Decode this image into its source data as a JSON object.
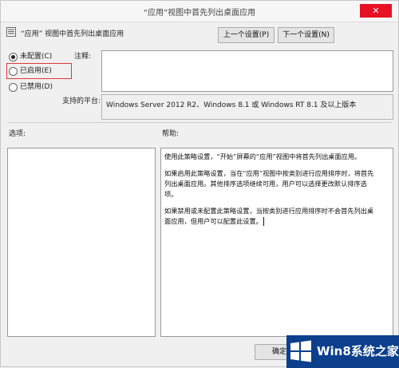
{
  "window": {
    "title": "“应用”视图中首先列出桌面应用",
    "close_glyph": "✕"
  },
  "header": {
    "policy_name": "“应用” 视图中首先列出桌面应用",
    "prev_label": "上一个设置(P)",
    "next_label": "下一个设置(N)"
  },
  "state": {
    "options": [
      {
        "label": "未配置(C)",
        "selected": true
      },
      {
        "label": "已启用(E)",
        "selected": false
      },
      {
        "label": "已禁用(D)",
        "selected": false
      }
    ]
  },
  "comment": {
    "label": "注释:",
    "value": ""
  },
  "platform": {
    "label": "支持的平台:",
    "value": "Windows Server 2012 R2、Windows 8.1 或 Windows RT 8.1 及以上版本"
  },
  "sections": {
    "options_label": "选项:",
    "help_label": "帮助:"
  },
  "help": {
    "paragraphs": [
      "使用此策略设置，“开始”屏幕的“应用”视图中将首先列出桌面应用。",
      "如果启用此策略设置，当在“应用”视图中按类别进行应用排序时，将首先列出桌面应用。其他排序选项继续可用，用户可以选择更改默认排序选项。",
      "如果禁用或未配置此策略设置，当按类别进行应用排序时不会首先列出桌面应用，但用户可以配置此设置。"
    ]
  },
  "footer": {
    "ok_label": "确定"
  },
  "watermark": {
    "text": "Win8系统之家"
  },
  "colors": {
    "accent_red": "#e0383e",
    "watermark_bg": "#0c3f8c",
    "close_bg": "#e81123"
  }
}
